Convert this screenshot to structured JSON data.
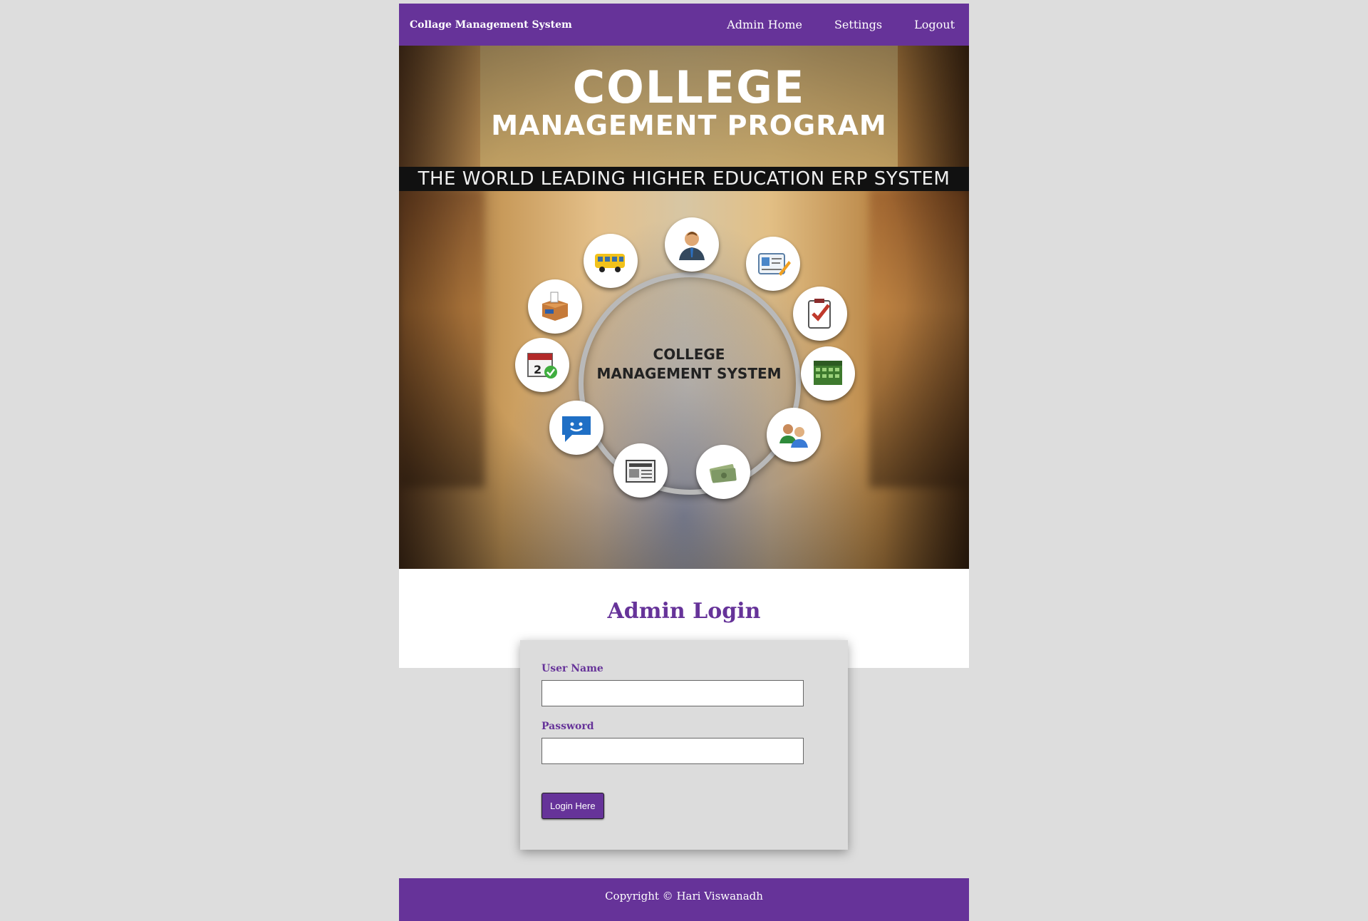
{
  "navbar": {
    "brand": "Collage Management System",
    "links": [
      "Admin Home",
      "Settings",
      "Logout"
    ]
  },
  "banner": {
    "title_line1": "COLLEGE",
    "title_line2": "MANAGEMENT PROGRAM",
    "tagline": "THE WORLD LEADING HIGHER EDUCATION ERP SYSTEM",
    "center_line1": "COLLEGE",
    "center_line2": "MANAGEMENT SYSTEM",
    "icons": [
      "person-icon",
      "id-card-icon",
      "checklist-icon",
      "calendar-grid-icon",
      "group-icon",
      "money-icon",
      "newspaper-icon",
      "chat-icon",
      "calendar-date-icon",
      "ballot-box-icon",
      "bus-icon"
    ]
  },
  "login": {
    "title": "Admin Login",
    "username_label": "User Name",
    "username_value": "",
    "password_label": "Password",
    "password_value": "",
    "submit_label": "Login Here"
  },
  "footer": {
    "text": "Copyright © Hari Viswanadh"
  },
  "colors": {
    "primary": "#663399",
    "background": "#dddddd"
  }
}
